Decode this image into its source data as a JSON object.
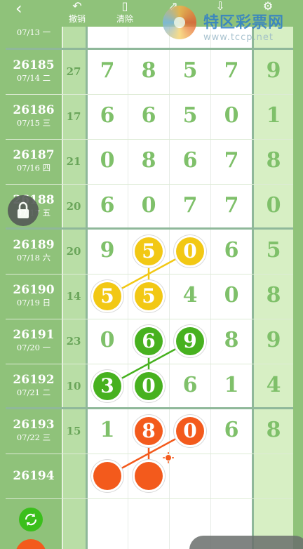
{
  "toolbar": {
    "back_icon": "chevron-left-icon",
    "undo_label": "撤销",
    "clear_label": "清除"
  },
  "logo": {
    "title": "特区彩票网",
    "url": "www.tccp.net"
  },
  "partial_top_row": {
    "date": "07/13 一"
  },
  "rows": [
    {
      "issue": "26185",
      "date": "07/14 二",
      "sum": "27",
      "digits": [
        "7",
        "8",
        "5",
        "7"
      ],
      "right": "9"
    },
    {
      "issue": "26186",
      "date": "07/15 三",
      "sum": "17",
      "digits": [
        "6",
        "6",
        "5",
        "0"
      ],
      "right": "1"
    },
    {
      "issue": "26187",
      "date": "07/16 四",
      "sum": "21",
      "digits": [
        "0",
        "8",
        "6",
        "7"
      ],
      "right": "8"
    },
    {
      "issue": "26188",
      "date": "07/17 五",
      "sum": "20",
      "digits": [
        "6",
        "0",
        "7",
        "7"
      ],
      "right": "0"
    },
    {
      "issue": "26189",
      "date": "07/18 六",
      "sum": "20",
      "digits": [
        "9",
        "5",
        "0",
        "6"
      ],
      "right": "5"
    },
    {
      "issue": "26190",
      "date": "07/19 日",
      "sum": "14",
      "digits": [
        "5",
        "5",
        "4",
        "0"
      ],
      "right": "8"
    },
    {
      "issue": "26191",
      "date": "07/20 一",
      "sum": "23",
      "digits": [
        "0",
        "6",
        "9",
        "8"
      ],
      "right": "9"
    },
    {
      "issue": "26192",
      "date": "07/21 二",
      "sum": "10",
      "digits": [
        "3",
        "0",
        "6",
        "1"
      ],
      "right": "4"
    },
    {
      "issue": "26193",
      "date": "07/22 三",
      "sum": "15",
      "digits": [
        "1",
        "8",
        "0",
        "6"
      ],
      "right": "8"
    },
    {
      "issue": "26194",
      "date": "",
      "sum": "",
      "digits": [
        "",
        "",
        "",
        ""
      ],
      "right": ""
    }
  ],
  "highlights": [
    {
      "row": 4,
      "col": 1,
      "value": "5",
      "color": "#f2c814"
    },
    {
      "row": 4,
      "col": 2,
      "value": "0",
      "color": "#f2c814"
    },
    {
      "row": 5,
      "col": 0,
      "value": "5",
      "color": "#f2c814"
    },
    {
      "row": 5,
      "col": 1,
      "value": "5",
      "color": "#f2c814"
    },
    {
      "row": 6,
      "col": 1,
      "value": "6",
      "color": "#47b11f"
    },
    {
      "row": 6,
      "col": 2,
      "value": "9",
      "color": "#47b11f"
    },
    {
      "row": 7,
      "col": 0,
      "value": "3",
      "color": "#47b11f"
    },
    {
      "row": 7,
      "col": 1,
      "value": "0",
      "color": "#47b11f"
    },
    {
      "row": 8,
      "col": 1,
      "value": "8",
      "color": "#f35a1c"
    },
    {
      "row": 8,
      "col": 2,
      "value": "0",
      "color": "#f35a1c"
    },
    {
      "row": 9,
      "col": 0,
      "value": "",
      "color": "#f35a1c"
    },
    {
      "row": 9,
      "col": 1,
      "value": "",
      "color": "#f35a1c"
    }
  ],
  "colors": {
    "column_green": "#8fc27a",
    "digit_green": "#7fc06a",
    "yellow": "#f2c814",
    "green": "#47b11f",
    "red": "#f35a1c"
  },
  "icons": {
    "lock": "lock-icon",
    "refresh": "refresh-icon",
    "undo": "undo-icon",
    "clear": "phone-clear-icon",
    "share": "share-icon",
    "download": "download-icon",
    "settings": "settings-icon"
  }
}
